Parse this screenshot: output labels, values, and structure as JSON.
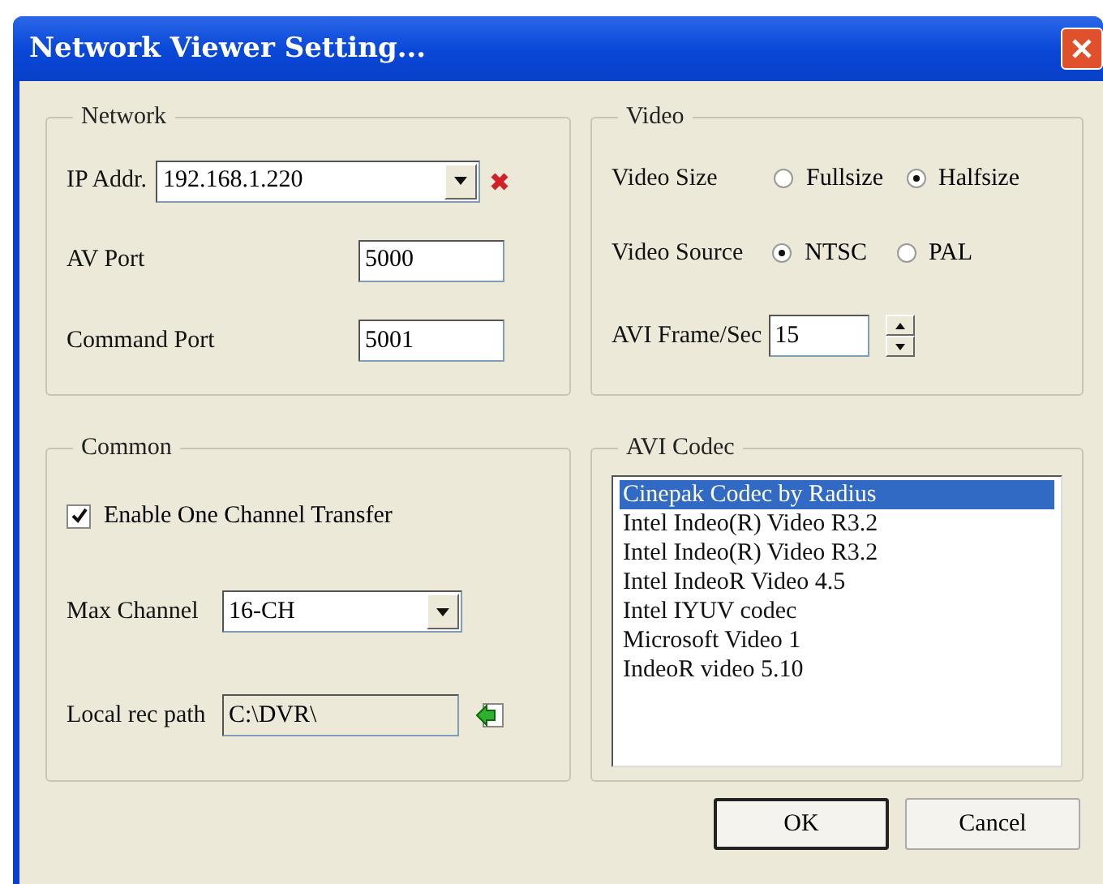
{
  "window": {
    "title": "Network Viewer Setting..."
  },
  "network": {
    "title": "Network",
    "ip": {
      "label": "IP Addr.",
      "value": "192.168.1.220"
    },
    "av_port": {
      "label": "AV Port",
      "value": "5000"
    },
    "command_port": {
      "label": "Command Port",
      "value": "5001"
    }
  },
  "video": {
    "title": "Video",
    "size": {
      "label": "Video Size",
      "options": [
        {
          "label": "Fullsize",
          "selected": false
        },
        {
          "label": "Halfsize",
          "selected": true
        }
      ]
    },
    "source": {
      "label": "Video Source",
      "options": [
        {
          "label": "NTSC",
          "selected": true
        },
        {
          "label": "PAL",
          "selected": false
        }
      ]
    },
    "frame_rate": {
      "label": "AVI Frame/Sec",
      "value": "15"
    }
  },
  "common": {
    "title": "Common",
    "one_channel": {
      "label": "Enable One Channel Transfer",
      "checked": true
    },
    "max_channel": {
      "label": "Max Channel",
      "value": "16-CH"
    },
    "rec_path": {
      "label": "Local rec path",
      "value": "C:\\DVR\\"
    }
  },
  "codec": {
    "title": "AVI Codec",
    "items": [
      {
        "label": "Cinepak Codec by Radius",
        "selected": true
      },
      {
        "label": "Intel Indeo(R) Video R3.2",
        "selected": false
      },
      {
        "label": "Intel Indeo(R) Video R3.2",
        "selected": false
      },
      {
        "label": "Intel IndeoR Video 4.5",
        "selected": false
      },
      {
        "label": "Intel IYUV codec",
        "selected": false
      },
      {
        "label": "Microsoft Video 1",
        "selected": false
      },
      {
        "label": "IndeoR video 5.10",
        "selected": false
      }
    ]
  },
  "buttons": [
    {
      "label": "OK",
      "default": true
    },
    {
      "label": "Cancel",
      "default": false
    }
  ]
}
